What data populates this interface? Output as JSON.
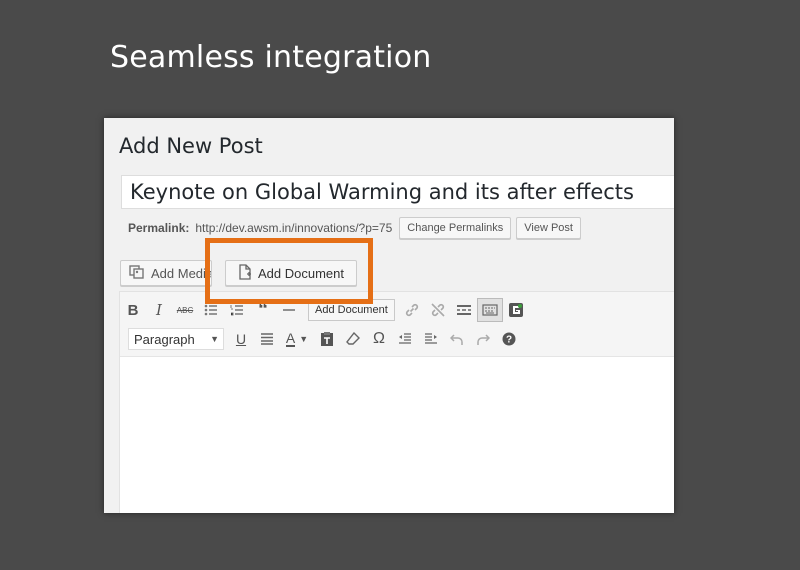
{
  "slide": {
    "title": "Seamless integration"
  },
  "screen": {
    "heading": "Add New Post",
    "post_title": "Keynote on Global Warming and its after effects",
    "permalink": {
      "label": "Permalink:",
      "url": "http://dev.awsm.in/innovations/?p=75",
      "change_button": "Change Permalinks",
      "view_button": "View Post"
    },
    "media_buttons": {
      "add_media": "Add Media",
      "add_document": "Add Document"
    },
    "toolbar": {
      "row1": [
        "bold",
        "italic",
        "strikethrough",
        "bulleted-list",
        "numbered-list",
        "blockquote",
        "horizontal-line",
        "add-document",
        "insert-link",
        "remove-link",
        "read-more",
        "toolbar-toggle",
        "google-drive"
      ],
      "add_document_label": "Add Document",
      "format_select": "Paragraph",
      "row2": [
        "underline",
        "justify",
        "text-color",
        "paste-as-text",
        "clear-formatting",
        "special-character",
        "outdent",
        "indent",
        "undo",
        "redo",
        "help"
      ]
    },
    "highlight_color": "#e56f16"
  }
}
